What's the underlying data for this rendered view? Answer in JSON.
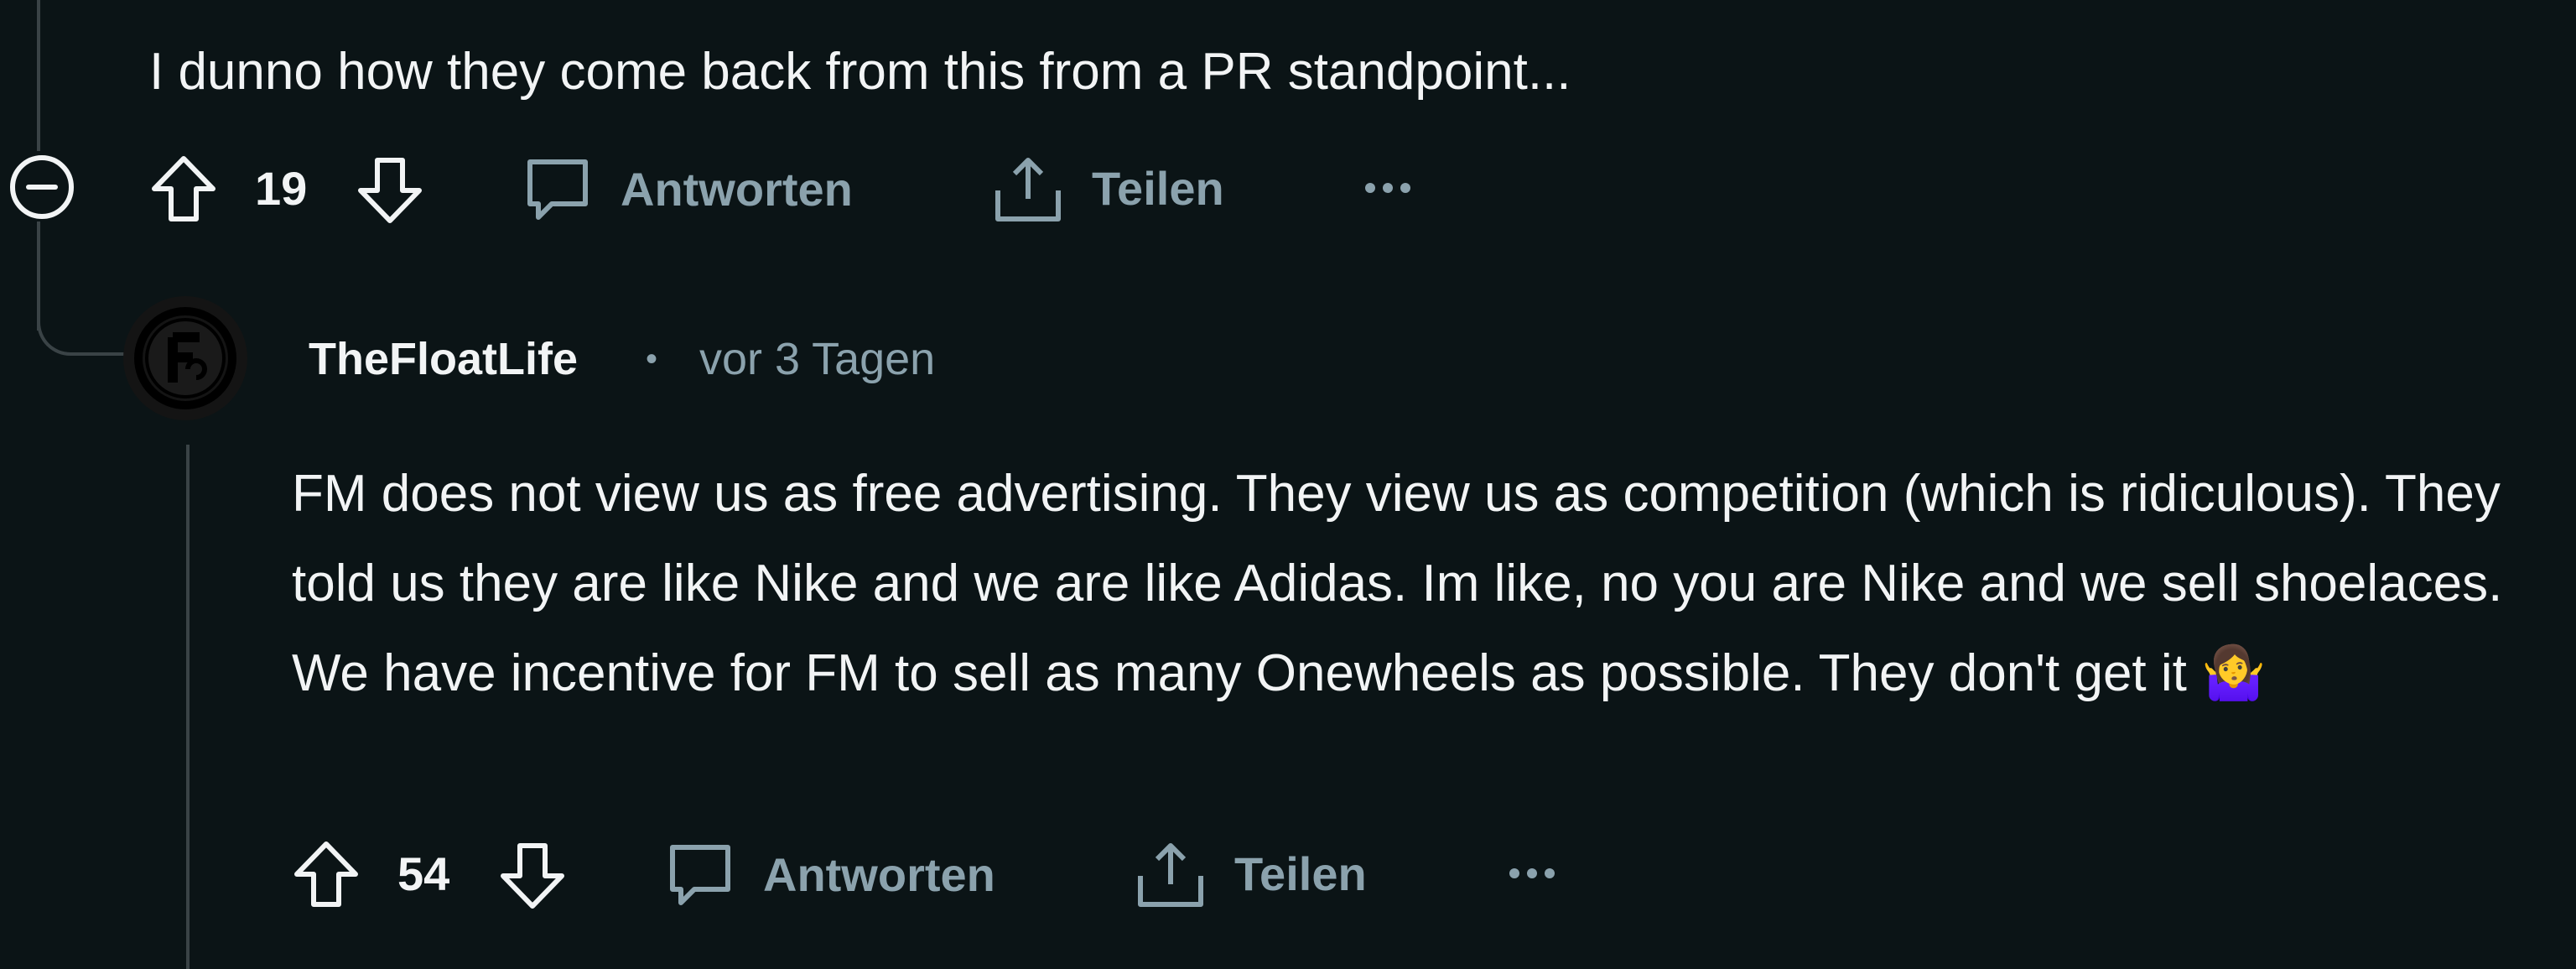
{
  "parent_comment": {
    "text": "I dunno how they come back from this from a PR standpoint...",
    "score": "19",
    "reply_label": "Antworten",
    "share_label": "Teilen"
  },
  "reply_comment": {
    "author": "TheFloatLife",
    "separator": "•",
    "timestamp": "vor 3 Tagen",
    "body": "FM does not view us as free advertising. They view us as competition (which is ridiculous). They told us they are like Nike and we are like Adidas. Im like, no you are Nike and we sell shoelaces. We have incentive for FM to sell as many Onewheels as possible. They don't get it",
    "emoji": "🤷‍♀️",
    "score": "54",
    "reply_label": "Antworten",
    "share_label": "Teilen"
  },
  "icons": [
    "collapse-icon",
    "upvote-icon",
    "downvote-icon",
    "comment-icon",
    "share-icon",
    "more-icon",
    "avatar"
  ],
  "colors": {
    "background": "#0b1416",
    "text": "#f2f4f5",
    "muted": "#8ba2ad",
    "thread_line": "#3a4346"
  }
}
